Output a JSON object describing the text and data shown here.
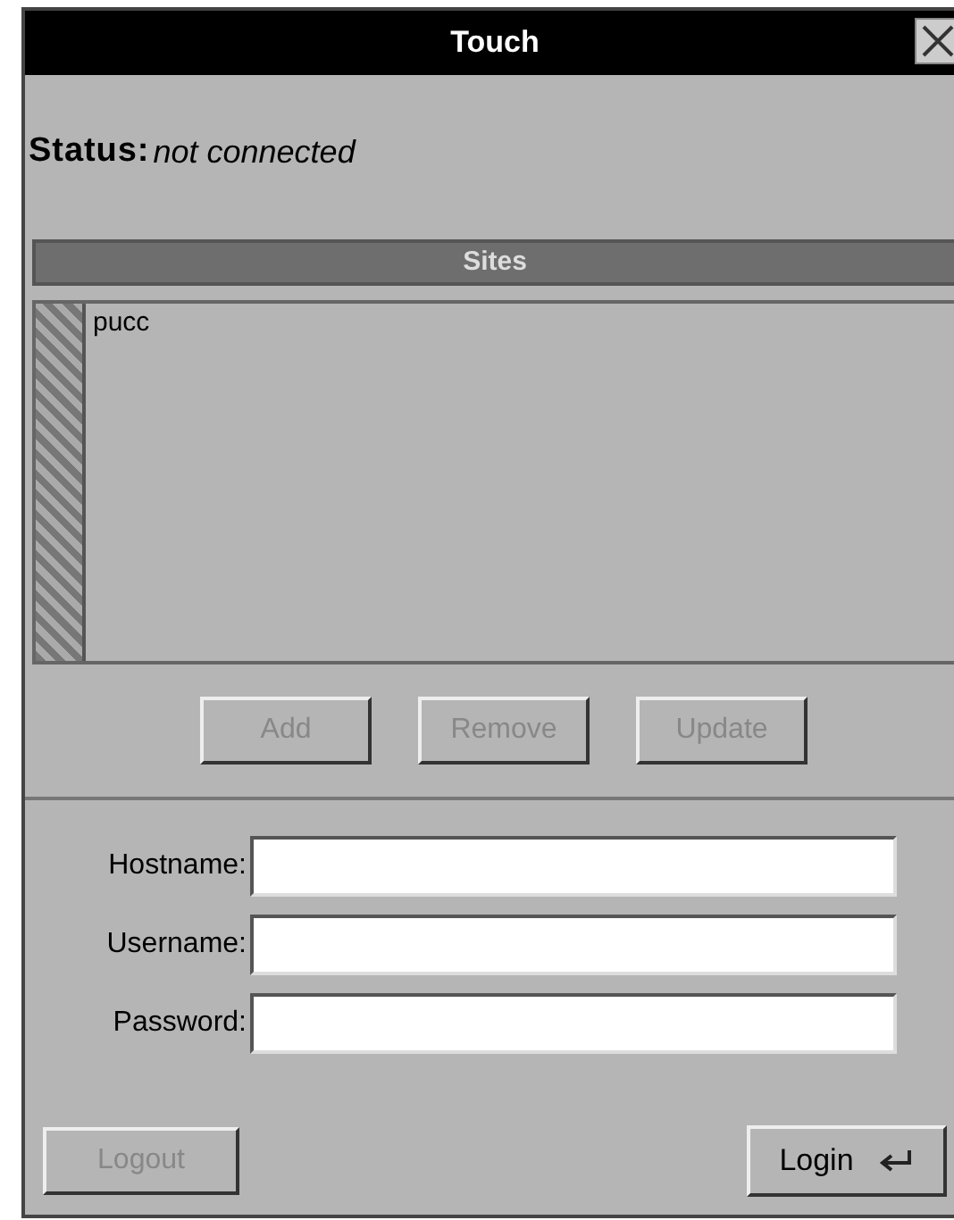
{
  "window": {
    "title": "Touch"
  },
  "status": {
    "label": "Status:",
    "value": "not connected"
  },
  "sites": {
    "title": "Sites",
    "items": [
      {
        "label": "pucc",
        "selected": false
      }
    ]
  },
  "site_buttons": [
    {
      "label": "Add",
      "disabled": true
    },
    {
      "label": "Remove",
      "disabled": true
    },
    {
      "label": "Update",
      "disabled": true
    }
  ],
  "fields": [
    {
      "label": "Hostname:"
    },
    {
      "label": "Username:"
    },
    {
      "label": "Password:"
    }
  ],
  "logout_button": {
    "label": "Logout",
    "disabled": true
  },
  "login_button": {
    "label": "Login",
    "disabled": false
  }
}
